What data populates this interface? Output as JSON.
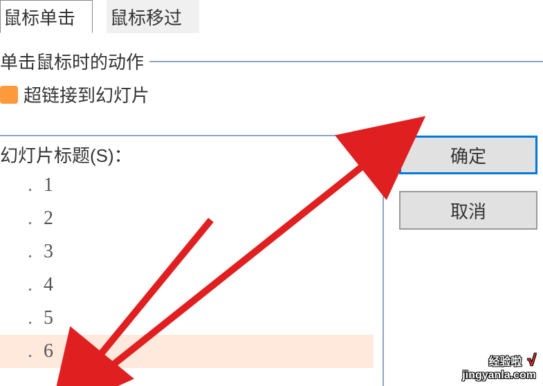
{
  "tabs": {
    "click": "鼠标单击",
    "hover": "鼠标移过"
  },
  "fieldset_label": "单击鼠标时的动作",
  "dialog_title": "超链接到幻灯片",
  "list_label": "幻灯片标题(S)：",
  "buttons": {
    "ok": "确定",
    "cancel": "取消"
  },
  "slides": {
    "items": [
      {
        "prefix": ".",
        "label": "1"
      },
      {
        "prefix": ".",
        "label": "2"
      },
      {
        "prefix": ".",
        "label": "3"
      },
      {
        "prefix": ".",
        "label": "4"
      },
      {
        "prefix": ".",
        "label": "5"
      },
      {
        "prefix": ".",
        "label": "6"
      }
    ],
    "selected_index": 5
  },
  "watermark": {
    "line1": "经验啦",
    "line2": "jingyanla.com",
    "check": "√"
  },
  "annotation": {
    "arrow_color": "#e02020"
  }
}
